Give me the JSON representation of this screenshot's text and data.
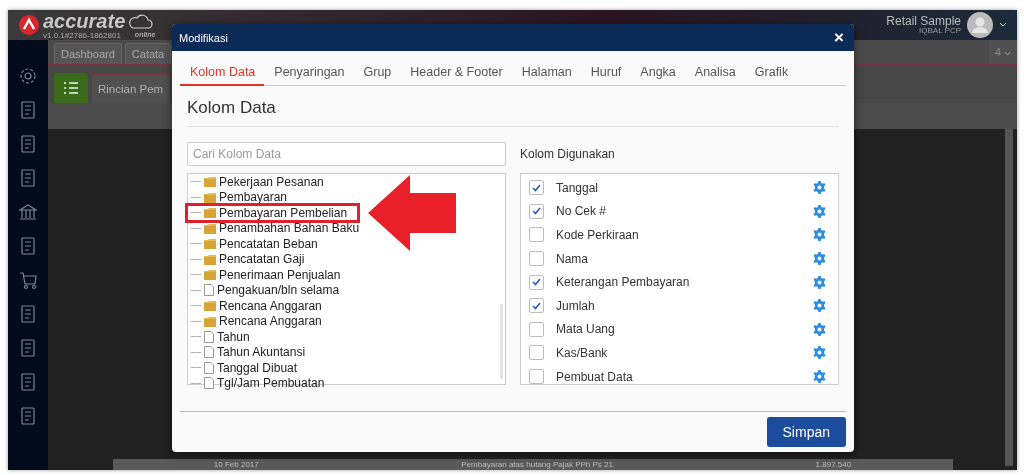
{
  "app": {
    "logo": "accurate",
    "logo_sub": "online",
    "version": "v1.0.1#2786-1862801",
    "company": "Retail Sample",
    "user": "IQBAL PCP",
    "tabs": [
      {
        "label": "Dashboard",
        "selected": false
      },
      {
        "label": "Catata",
        "selected": false
      }
    ],
    "tab_count": "4",
    "page_title": "Rincian Pem",
    "background_row": [
      "10 Feb 2017",
      "Pembayaran atas hutang Pajak PPh Ps 21",
      "1.897.540"
    ]
  },
  "dialog": {
    "title": "Modifikasi",
    "close": "×",
    "tabs": [
      {
        "label": "Kolom Data",
        "selected": true
      },
      {
        "label": "Penyaringan",
        "selected": false
      },
      {
        "label": "Grup",
        "selected": false
      },
      {
        "label": "Header & Footer",
        "selected": false
      },
      {
        "label": "Halaman",
        "selected": false
      },
      {
        "label": "Huruf",
        "selected": false
      },
      {
        "label": "Angka",
        "selected": false
      },
      {
        "label": "Analisa",
        "selected": false
      },
      {
        "label": "Grafik",
        "selected": false
      }
    ],
    "heading": "Kolom Data",
    "search": {
      "placeholder": "Cari Kolom Data"
    },
    "tree": [
      {
        "label": "Pekerjaan Pesanan",
        "kind": "folder",
        "callout": false
      },
      {
        "label": "Pembayaran",
        "kind": "folder",
        "callout": false
      },
      {
        "label": "Pembayaran Pembelian",
        "kind": "folder",
        "callout": true
      },
      {
        "label": "Penambahan Bahan Baku",
        "kind": "folder",
        "callout": false
      },
      {
        "label": "Pencatatan Beban",
        "kind": "folder",
        "callout": false
      },
      {
        "label": "Pencatatan Gaji",
        "kind": "folder",
        "callout": false
      },
      {
        "label": "Penerimaan Penjualan",
        "kind": "folder",
        "callout": false
      },
      {
        "label": "Pengakuan/bln selama",
        "kind": "field",
        "callout": false
      },
      {
        "label": "Rencana Anggaran",
        "kind": "folder",
        "callout": false
      },
      {
        "label": "Rencana Anggaran",
        "kind": "folder",
        "callout": false
      },
      {
        "label": "Tahun",
        "kind": "field",
        "callout": false
      },
      {
        "label": "Tahun Akuntansi",
        "kind": "field",
        "callout": false
      },
      {
        "label": "Tanggal Dibuat",
        "kind": "field",
        "callout": false
      },
      {
        "label": "Tgl/Jam Pembuatan",
        "kind": "field",
        "callout": false
      }
    ],
    "used_label": "Kolom Digunakan",
    "columns": [
      {
        "label": "Tanggal",
        "checked": true
      },
      {
        "label": "No Cek #",
        "checked": true
      },
      {
        "label": "Kode Perkiraan",
        "checked": false
      },
      {
        "label": "Nama",
        "checked": false
      },
      {
        "label": "Keterangan Pembayaran",
        "checked": true
      },
      {
        "label": "Jumlah",
        "checked": true
      },
      {
        "label": "Mata Uang",
        "checked": false
      },
      {
        "label": "Kas/Bank",
        "checked": false
      },
      {
        "label": "Pembuat Data",
        "checked": false
      }
    ],
    "save": "Simpan"
  }
}
